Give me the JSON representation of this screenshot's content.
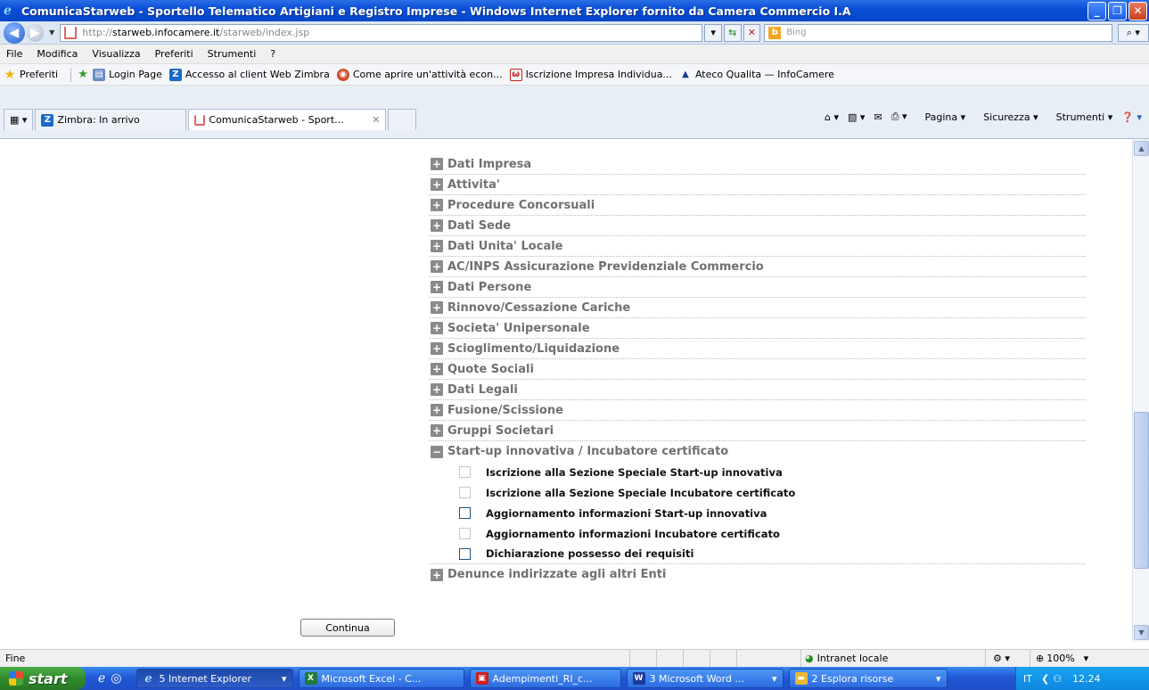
{
  "window": {
    "title": "ComunicaStarweb - Sportello Telematico Artigiani e Registro Imprese - Windows Internet Explorer fornito da Camera Commercio I.A"
  },
  "address_bar": {
    "url_prefix": "http://",
    "url_host": "starweb.infocamere.it",
    "url_path": "/starweb/index.jsp",
    "search_placeholder": "Bing"
  },
  "menu": {
    "items": [
      "File",
      "Modifica",
      "Visualizza",
      "Preferiti",
      "Strumenti",
      "?"
    ]
  },
  "favorites": {
    "label": "Preferiti",
    "items": [
      "Login Page",
      "Accesso al client Web Zimbra",
      "Come aprire un'attività econ...",
      "Iscrizione Impresa Individua...",
      "Ateco Qualita — InfoCamere"
    ]
  },
  "tabs": [
    {
      "label": "Zimbra: In arrivo"
    },
    {
      "label": "ComunicaStarweb - Sport..."
    }
  ],
  "command_bar": {
    "page": "Pagina",
    "security": "Sicurezza",
    "tools": "Strumenti"
  },
  "form": {
    "sections": [
      {
        "label": "Dati Impresa",
        "expanded": false
      },
      {
        "label": "Attivita'",
        "expanded": false
      },
      {
        "label": "Procedure Concorsuali",
        "expanded": false
      },
      {
        "label": "Dati Sede",
        "expanded": false
      },
      {
        "label": "Dati Unita' Locale",
        "expanded": false
      },
      {
        "label": "AC/INPS Assicurazione Previdenziale Commercio",
        "expanded": false
      },
      {
        "label": "Dati Persone",
        "expanded": false
      },
      {
        "label": "Rinnovo/Cessazione Cariche",
        "expanded": false
      },
      {
        "label": "Societa' Unipersonale",
        "expanded": false
      },
      {
        "label": "Scioglimento/Liquidazione",
        "expanded": false
      },
      {
        "label": "Quote Sociali",
        "expanded": false
      },
      {
        "label": "Dati Legali",
        "expanded": false
      },
      {
        "label": "Fusione/Scissione",
        "expanded": false
      },
      {
        "label": "Gruppi Societari",
        "expanded": false
      },
      {
        "label": "Start-up innovativa / Incubatore certificato",
        "expanded": true
      },
      {
        "label": "Denunce indirizzate agli altri Enti",
        "expanded": false
      }
    ],
    "startup_options": [
      {
        "label": "Iscrizione alla Sezione Speciale Start-up innovativa",
        "enabled": false
      },
      {
        "label": "Iscrizione alla Sezione Speciale Incubatore certificato",
        "enabled": false
      },
      {
        "label": "Aggiornamento informazioni Start-up innovativa",
        "enabled": true
      },
      {
        "label": "Aggiornamento informazioni Incubatore certificato",
        "enabled": false
      },
      {
        "label": "Dichiarazione possesso dei requisiti",
        "enabled": true
      }
    ],
    "continue_label": "Continua"
  },
  "status_bar": {
    "text": "Fine",
    "zone": "Intranet locale",
    "zoom": "100%"
  },
  "taskbar": {
    "start_label": "start",
    "tasks": [
      "5 Internet Explorer",
      "Microsoft Excel - C...",
      "Adempimenti_RI_c...",
      "3 Microsoft Word ...",
      "2 Esplora risorse"
    ],
    "language": "IT",
    "clock": "12.24"
  },
  "colors": {
    "titlebar": "#0a4fd6",
    "section_text": "#707070",
    "taskbar": "#2157d6",
    "start": "#2e8c2a"
  }
}
